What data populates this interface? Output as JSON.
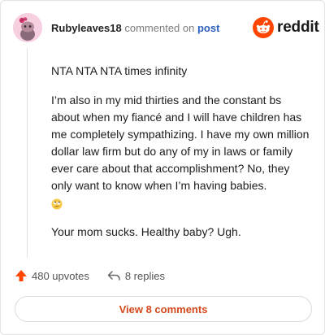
{
  "header": {
    "username": "Rubyleaves18",
    "commented_text": "commented on",
    "post_link": "post"
  },
  "brand": {
    "logo_text": "reddit",
    "logo_color": "#FF4500"
  },
  "comment": {
    "paragraphs": [
      "NTA NTA NTA times infinity",
      "I’m also in my mid thirties and the constant bs about when my fiancé and I will have children has me completely sympathizing. I have my own million dollar law firm but do any of my in laws or family ever care about that accomplishment? No, they only want to know when I’m having babies.",
      "Your mom sucks. Healthy baby? Ugh."
    ],
    "emoji": "eye-roll-emoji"
  },
  "actions": {
    "upvotes": "480 upvotes",
    "replies": "8 replies",
    "upvote_color": "#FF4500"
  },
  "view_button": {
    "label": "View 8 comments",
    "color": "#D4481C"
  }
}
